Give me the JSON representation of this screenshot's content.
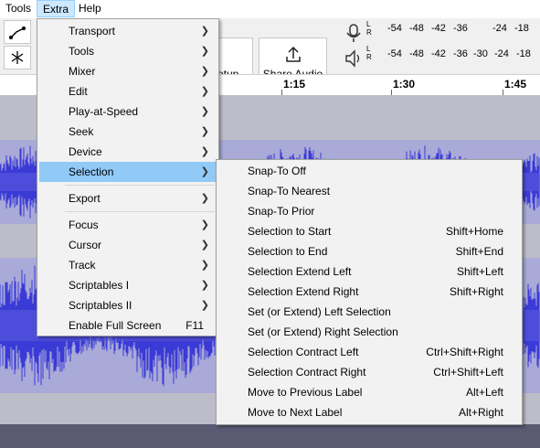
{
  "menubar": {
    "items": [
      "Tools",
      "Extra",
      "Help"
    ]
  },
  "toolbar": {
    "setup_label": "etup",
    "share_audio_label": "Share Audio",
    "meter_ticks": [
      "-54",
      "-48",
      "-42",
      "-36",
      "-24",
      "-18"
    ],
    "meter_ticks_bottom": [
      "-54",
      "-48",
      "-42",
      "-36",
      "-30",
      "-24",
      "-18"
    ],
    "channels": [
      "L",
      "R"
    ]
  },
  "timeline": {
    "labels": [
      "1:15",
      "1:30",
      "1:45"
    ]
  },
  "extra_menu": {
    "items": [
      {
        "label": "Transport",
        "submenu": true
      },
      {
        "label": "Tools",
        "submenu": true
      },
      {
        "label": "Mixer",
        "submenu": true
      },
      {
        "label": "Edit",
        "submenu": true
      },
      {
        "label": "Play-at-Speed",
        "submenu": true
      },
      {
        "label": "Seek",
        "submenu": true
      },
      {
        "label": "Device",
        "submenu": true
      },
      {
        "label": "Selection",
        "submenu": true,
        "highlighted": true
      },
      {
        "label": "Export",
        "submenu": true
      },
      {
        "label": "Focus",
        "submenu": true
      },
      {
        "label": "Cursor",
        "submenu": true
      },
      {
        "label": "Track",
        "submenu": true
      },
      {
        "label": "Scriptables I",
        "submenu": true
      },
      {
        "label": "Scriptables II",
        "submenu": true
      },
      {
        "label": "Enable Full Screen",
        "shortcut": "F11"
      }
    ]
  },
  "selection_submenu": {
    "items": [
      {
        "label": "Snap-To Off",
        "shortcut": ""
      },
      {
        "label": "Snap-To Nearest",
        "shortcut": ""
      },
      {
        "label": "Snap-To Prior",
        "shortcut": ""
      },
      {
        "label": "Selection to Start",
        "shortcut": "Shift+Home"
      },
      {
        "label": "Selection to End",
        "shortcut": "Shift+End"
      },
      {
        "label": "Selection Extend Left",
        "shortcut": "Shift+Left"
      },
      {
        "label": "Selection Extend Right",
        "shortcut": "Shift+Right"
      },
      {
        "label": "Set (or Extend) Left Selection",
        "shortcut": ""
      },
      {
        "label": "Set (or Extend) Right Selection",
        "shortcut": ""
      },
      {
        "label": "Selection Contract Left",
        "shortcut": "Ctrl+Shift+Right"
      },
      {
        "label": "Selection Contract Right",
        "shortcut": "Ctrl+Shift+Left"
      },
      {
        "label": "Move to Previous Label",
        "shortcut": "Alt+Left"
      },
      {
        "label": "Move to Next Label",
        "shortcut": "Alt+Right"
      }
    ]
  },
  "colors": {
    "waveform": "#3a3ad6",
    "highlight": "#91c9f7",
    "menu_bg": "#f2f2f2"
  }
}
